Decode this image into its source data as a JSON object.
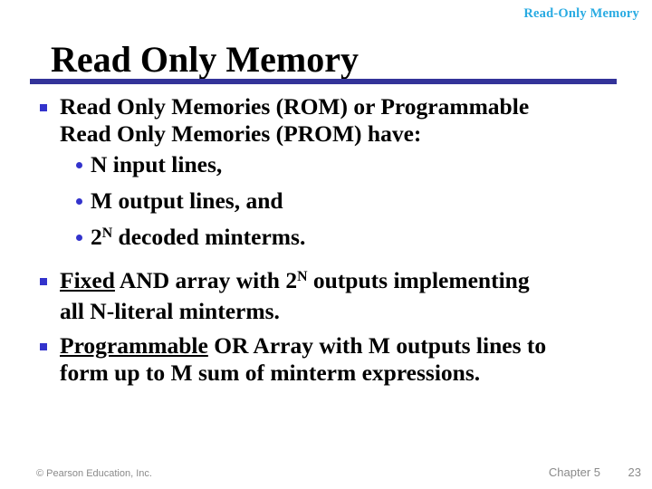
{
  "header": {
    "running_title": "Read-Only Memory",
    "color": "#29ABE2"
  },
  "title": {
    "text": "Read Only Memory",
    "rule_color": "#333399"
  },
  "bullets": {
    "marker_square_color": "#3333CC",
    "marker_dot_color": "#3333CC",
    "items": [
      {
        "level": 1,
        "line1": "Read Only Memories (ROM) or Programmable",
        "line2": "Read Only Memories (PROM) have:"
      },
      {
        "level": 2,
        "text": "N input lines,"
      },
      {
        "level": 2,
        "text_pre": "M output lines, and"
      },
      {
        "level": 2,
        "base": "2",
        "exp": "N",
        "rest": " decoded minterms."
      },
      {
        "level": 1,
        "underlined": "Fixed",
        "mid": " AND array with 2",
        "exp": "N",
        "after": " outputs implementing",
        "line2": "all N-literal minterms."
      },
      {
        "level": 1,
        "underlined": "Programmable",
        "after": " OR Array with  M outputs lines to",
        "line2": "form up to M sum of minterm expressions."
      }
    ]
  },
  "footer": {
    "copyright": "© Pearson Education, Inc.",
    "chapter": "Chapter 5",
    "page_number": "23",
    "color": "#8a8a8a"
  }
}
